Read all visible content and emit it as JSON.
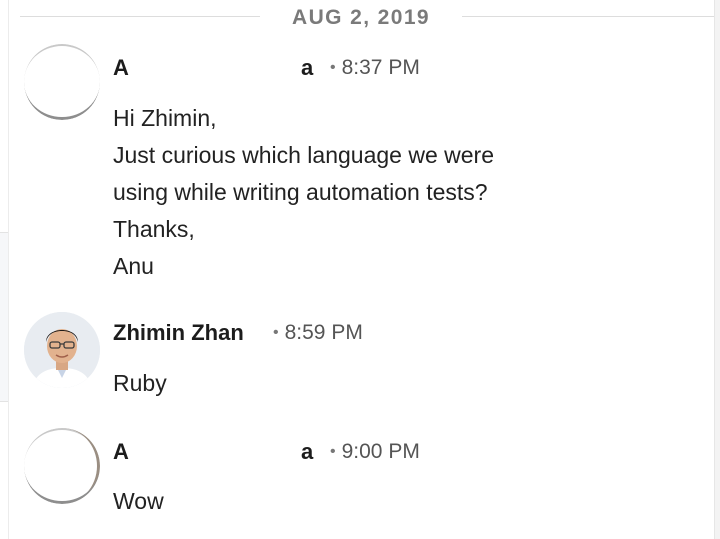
{
  "date_divider": "AUG 2, 2019",
  "messages": [
    {
      "sender_start": "A",
      "sender_end": "a",
      "time": "8:37 PM",
      "lines": [
        "Hi Zhimin,",
        "Just curious which language we were",
        "using while writing automation tests?",
        "Thanks,",
        "Anu"
      ]
    },
    {
      "sender": "Zhimin Zhan",
      "time": "8:59 PM",
      "lines": [
        "Ruby"
      ]
    },
    {
      "sender_start": "A",
      "sender_end": "a",
      "time": "9:00 PM",
      "lines": [
        "Wow"
      ]
    }
  ],
  "separator": "•"
}
